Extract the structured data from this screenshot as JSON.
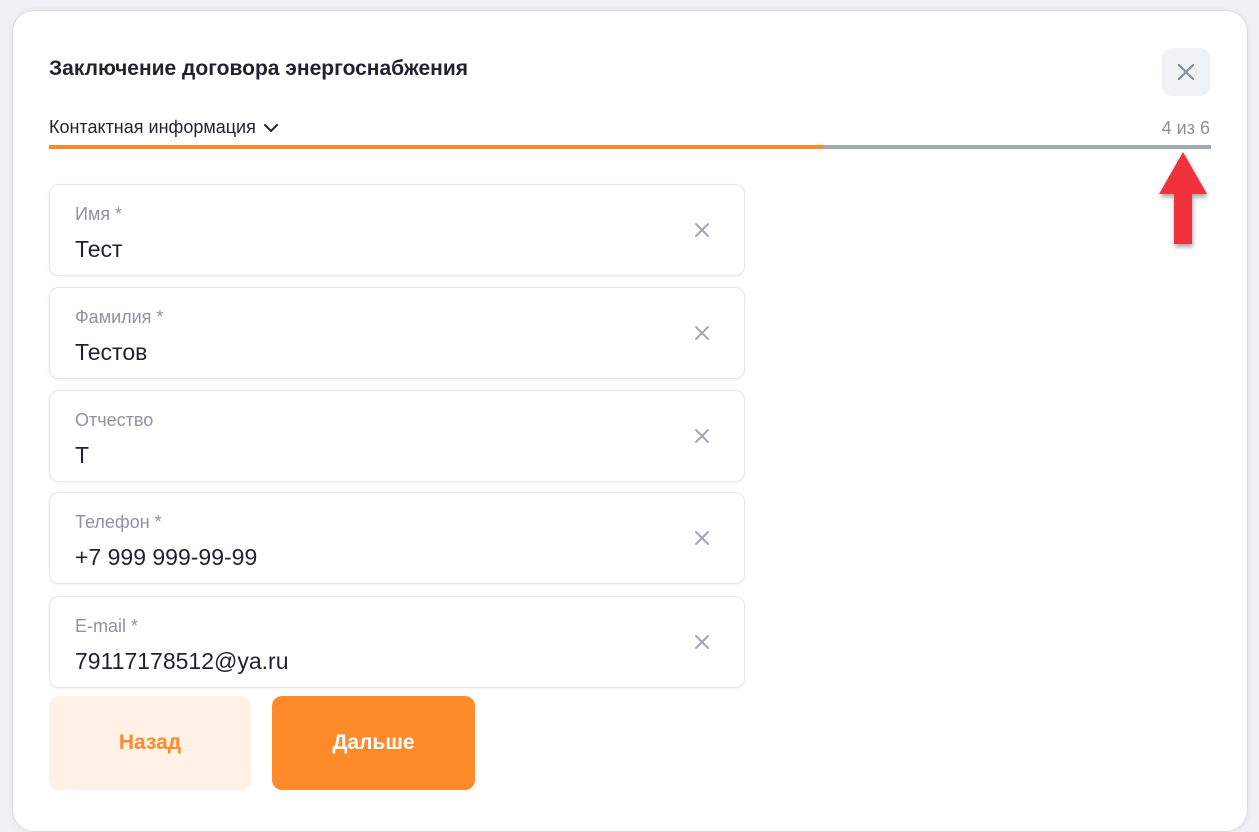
{
  "modal": {
    "title": "Заключение договора энергоснабжения",
    "close_icon": "close-icon"
  },
  "step": {
    "label": "Контактная информация",
    "icon": "chevron-down-icon",
    "counter": "4 из 6",
    "progress_fraction": 0.667
  },
  "fields": [
    {
      "label": "Имя  *",
      "value": "Тест"
    },
    {
      "label": "Фамилия  *",
      "value": "Тестов"
    },
    {
      "label": "Отчество",
      "value": "Т"
    },
    {
      "label": "Телефон  *",
      "value": "+7 999 999-99-99"
    },
    {
      "label": "E-mail  *",
      "value": "79117178512@ya.ru"
    }
  ],
  "buttons": {
    "back_label": "Назад",
    "next_label": "Дальше"
  },
  "colors": {
    "accent": "#ff8a2a",
    "annotation_arrow": "#f0323c"
  }
}
